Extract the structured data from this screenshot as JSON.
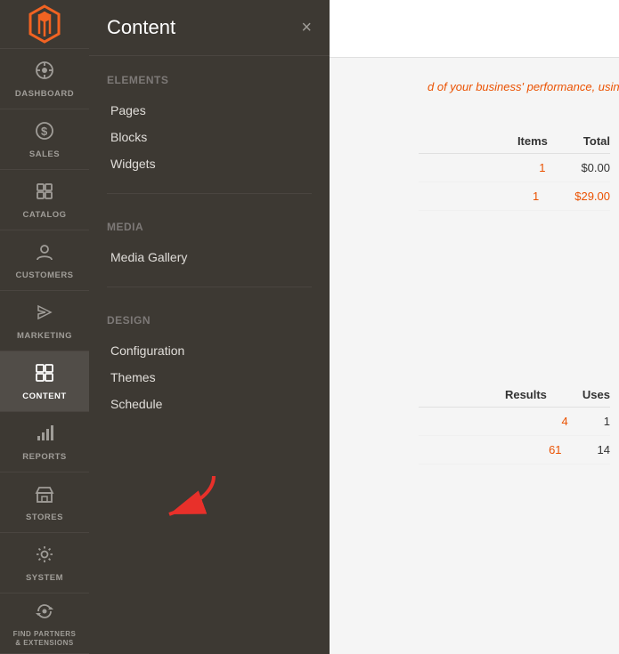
{
  "app": {
    "title": "Magento Admin"
  },
  "sidebar": {
    "items": [
      {
        "id": "dashboard",
        "label": "DASHBOARD",
        "icon": "⊙",
        "active": false
      },
      {
        "id": "sales",
        "label": "SALES",
        "icon": "$",
        "active": false
      },
      {
        "id": "catalog",
        "label": "CATALOG",
        "icon": "◈",
        "active": false
      },
      {
        "id": "customers",
        "label": "CUSTOMERS",
        "icon": "👤",
        "active": false
      },
      {
        "id": "marketing",
        "label": "MARKETING",
        "icon": "📢",
        "active": false
      },
      {
        "id": "content",
        "label": "CONTENT",
        "icon": "▦",
        "active": true
      },
      {
        "id": "reports",
        "label": "REPORTS",
        "icon": "📊",
        "active": false
      },
      {
        "id": "stores",
        "label": "STORES",
        "icon": "🏪",
        "active": false
      },
      {
        "id": "system",
        "label": "SYSTEM",
        "icon": "⚙",
        "active": false
      },
      {
        "id": "partners",
        "label": "FIND PARTNERS & EXTENSIONS",
        "icon": "🔗",
        "active": false
      }
    ]
  },
  "dropdown": {
    "title": "Content",
    "close_label": "×",
    "sections": [
      {
        "id": "elements",
        "title": "Elements",
        "items": [
          {
            "id": "pages",
            "label": "Pages"
          },
          {
            "id": "blocks",
            "label": "Blocks"
          },
          {
            "id": "widgets",
            "label": "Widgets"
          }
        ]
      },
      {
        "id": "media",
        "title": "Media",
        "items": [
          {
            "id": "media-gallery",
            "label": "Media Gallery"
          }
        ]
      },
      {
        "id": "design",
        "title": "Design",
        "items": [
          {
            "id": "configuration",
            "label": "Configuration"
          },
          {
            "id": "themes",
            "label": "Themes"
          },
          {
            "id": "schedule",
            "label": "Schedule"
          }
        ]
      }
    ]
  },
  "main": {
    "hint_text": "d of your business' performance, using our dynar",
    "table1": {
      "headers": [
        "Items",
        "Total"
      ],
      "rows": [
        {
          "items": "1",
          "total": "$0.00"
        },
        {
          "items": "1",
          "total": "$29.00"
        }
      ]
    },
    "table2": {
      "headers": [
        "Results",
        "Uses"
      ],
      "rows": [
        {
          "results": "4",
          "uses": "1"
        },
        {
          "results": "61",
          "uses": "14"
        }
      ]
    }
  }
}
